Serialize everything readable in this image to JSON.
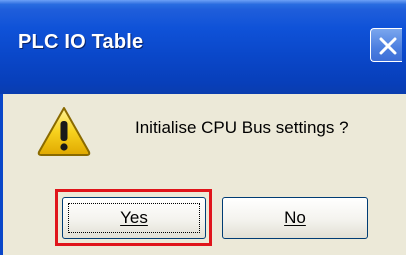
{
  "dialog": {
    "title": "PLC IO Table",
    "message": "Initialise CPU Bus settings ?",
    "icon": "warning-icon",
    "buttons": {
      "yes_label": "Yes",
      "no_label": "No"
    }
  },
  "colors": {
    "titlebar": "#0A47C9",
    "dialog_bg": "#ECE9D8",
    "highlight_border": "#E0151B",
    "warning_fill": "#F7D21E"
  }
}
